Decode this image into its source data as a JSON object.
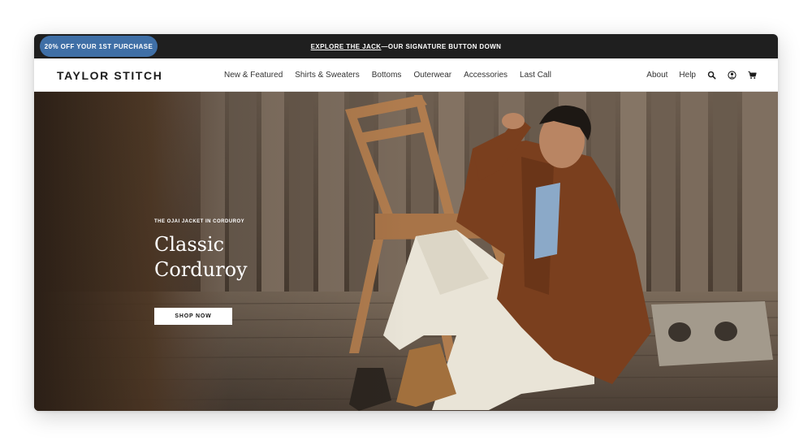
{
  "promo_bar": {
    "pill_label": "20% OFF YOUR 1ST PURCHASE",
    "link_text": "EXPLORE THE JACK",
    "tagline": "—OUR SIGNATURE BUTTON DOWN"
  },
  "header": {
    "logo": "TAYLOR STITCH",
    "nav": [
      "New & Featured",
      "Shirts & Sweaters",
      "Bottoms",
      "Outerwear",
      "Accessories",
      "Last Call"
    ],
    "utility_links": [
      "About",
      "Help"
    ],
    "icons": [
      "search-icon",
      "account-icon",
      "cart-icon"
    ]
  },
  "hero": {
    "eyebrow": "THE OJAI JACKET IN CORDUROY",
    "headline_line1": "Classic",
    "headline_line2": "Corduroy",
    "cta_label": "SHOP NOW"
  },
  "colors": {
    "promo_bg": "#1f1f1f",
    "pill_bg": "#3f6fa6",
    "header_bg": "#ffffff",
    "jacket": "#7a3f1e",
    "pants": "#e9e4d7"
  }
}
